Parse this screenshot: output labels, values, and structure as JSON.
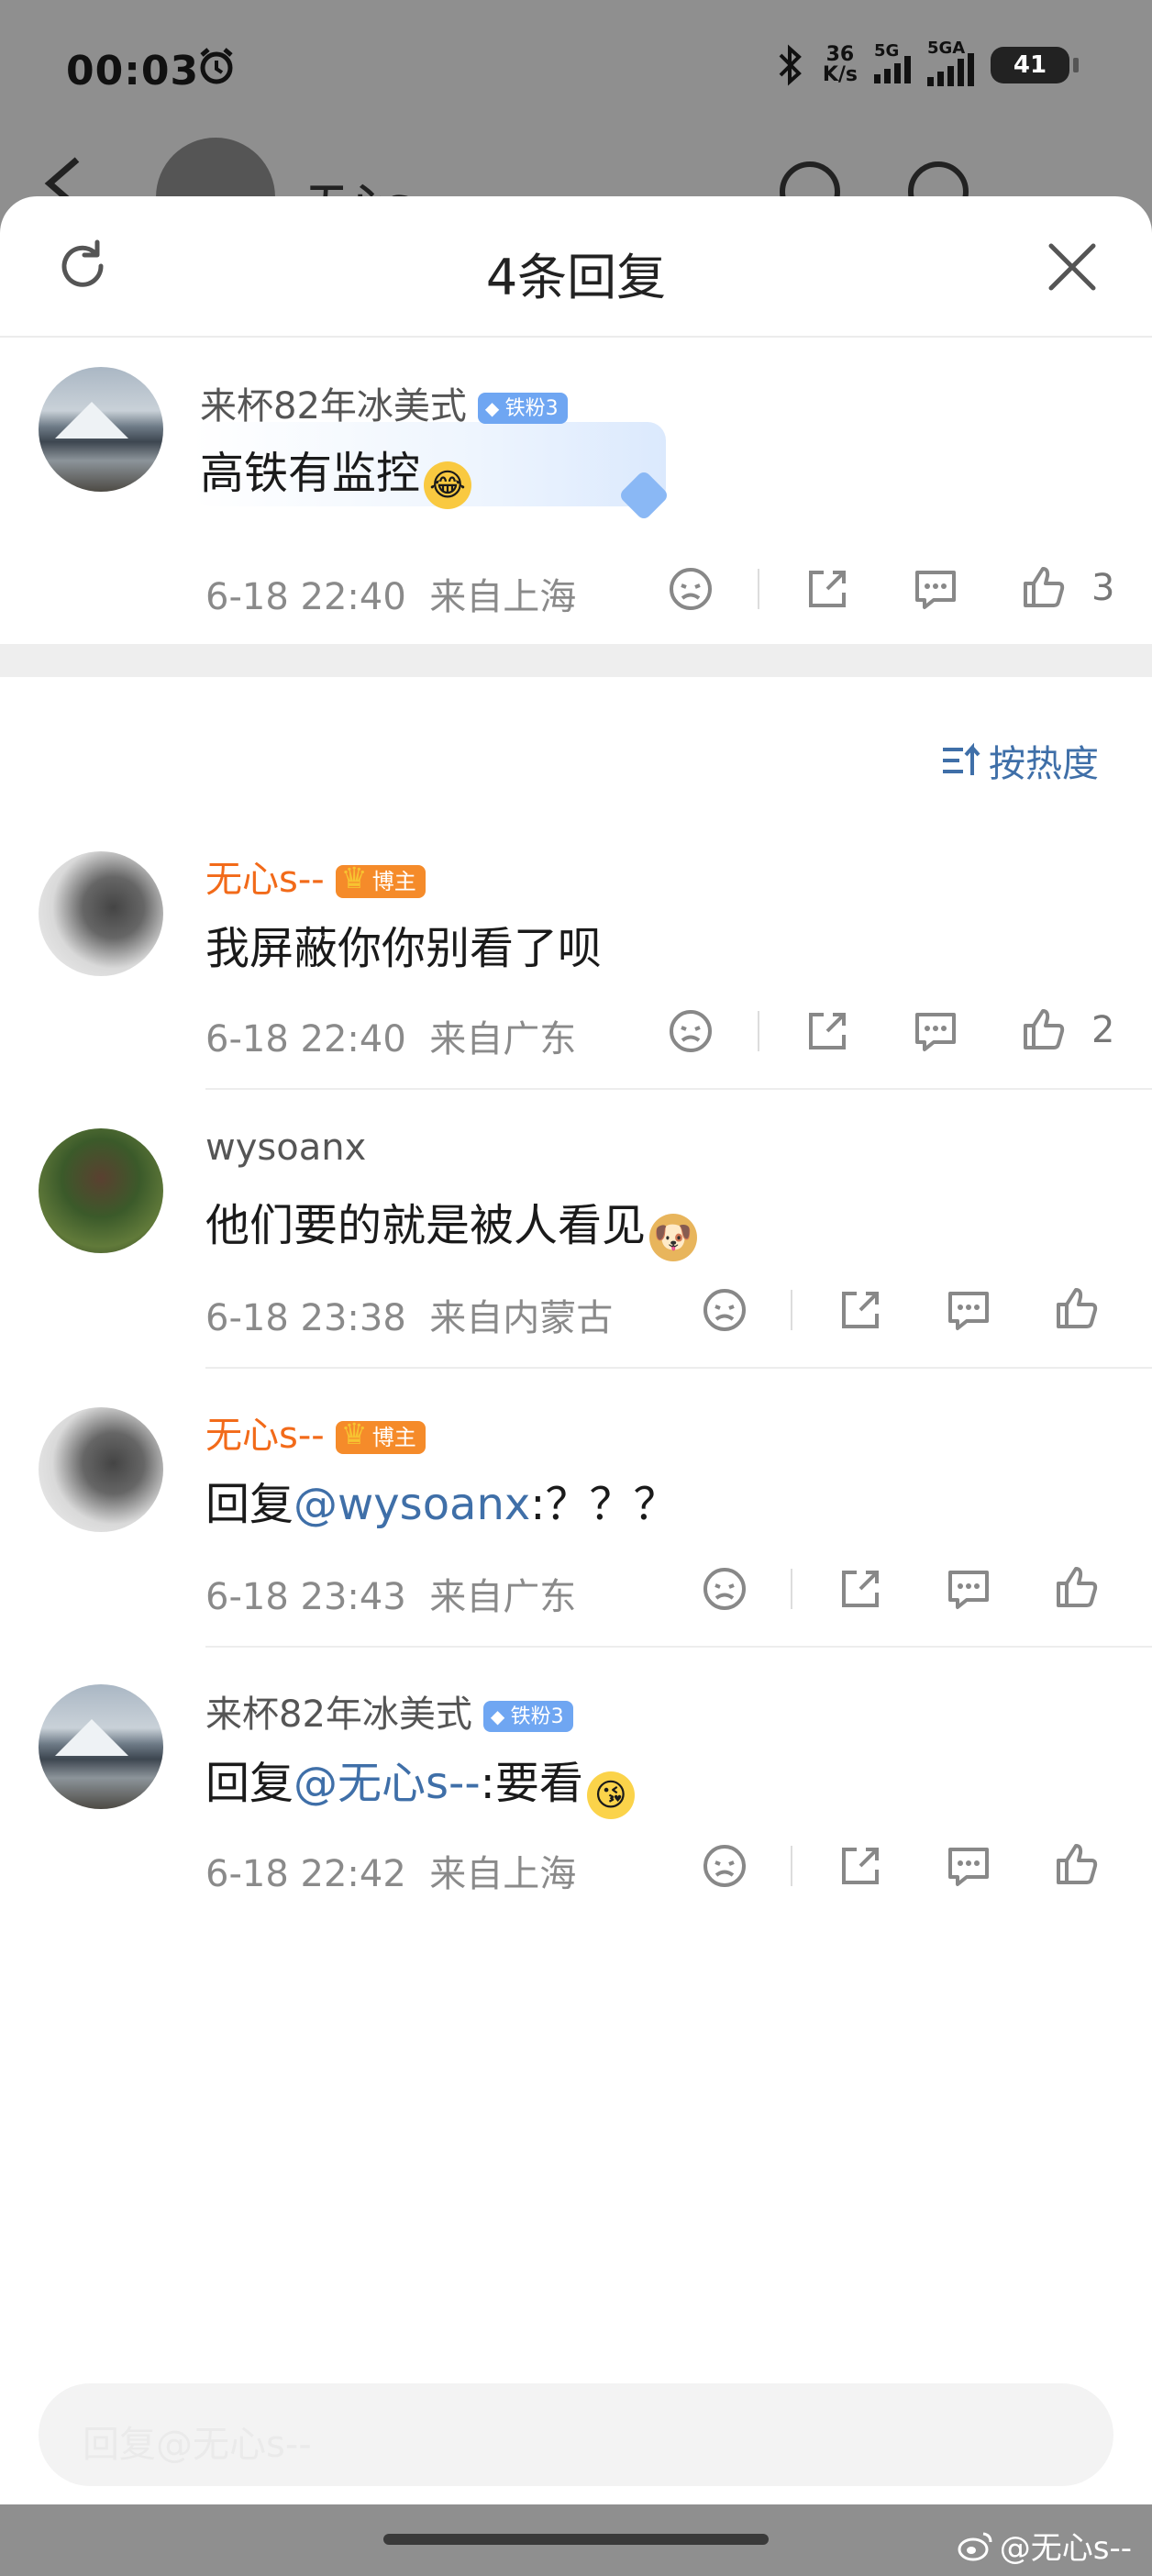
{
  "status_bar": {
    "time": "00:03",
    "net_speed_top": "36",
    "net_speed_bottom": "K/s",
    "sig1_label": "5G",
    "sig2_label": "5GA",
    "battery": "41"
  },
  "underlying_page": {
    "title": "无心s--"
  },
  "sheet": {
    "title": "4条回复"
  },
  "root_comment": {
    "author": "来杯82年冰美式",
    "badge": "铁粉3",
    "text": "高铁有监控",
    "time": "6-18 22:40",
    "location": "来自上海",
    "likes": "3"
  },
  "sort_label": "按热度",
  "replies": [
    {
      "author": "无心s--",
      "badge": "博主",
      "text": "我屏蔽你你别看了呗",
      "time": "6-18 22:40",
      "location": "来自广东",
      "likes": "2"
    },
    {
      "author": "wysoanx",
      "text": "他们要的就是被人看见",
      "time": "6-18 23:38",
      "location": "来自内蒙古"
    },
    {
      "author": "无心s--",
      "badge": "博主",
      "reply_prefix": "回复",
      "mention": "@wysoanx",
      "text": ":？？？",
      "time": "6-18 23:43",
      "location": "来自广东"
    },
    {
      "author": "来杯82年冰美式",
      "badge": "铁粉3",
      "reply_prefix": "回复",
      "mention": "@无心s--",
      "text": ":要看",
      "time": "6-18 22:42",
      "location": "来自上海"
    }
  ],
  "input": {
    "placeholder": "回复@无心s--"
  },
  "watermark": "@无心s--",
  "colors": {
    "accent_orange": "#f26a19",
    "link_blue": "#3f6fa8",
    "fan_badge": "#6fa6f2",
    "vip_badge": "#f58b2a"
  }
}
